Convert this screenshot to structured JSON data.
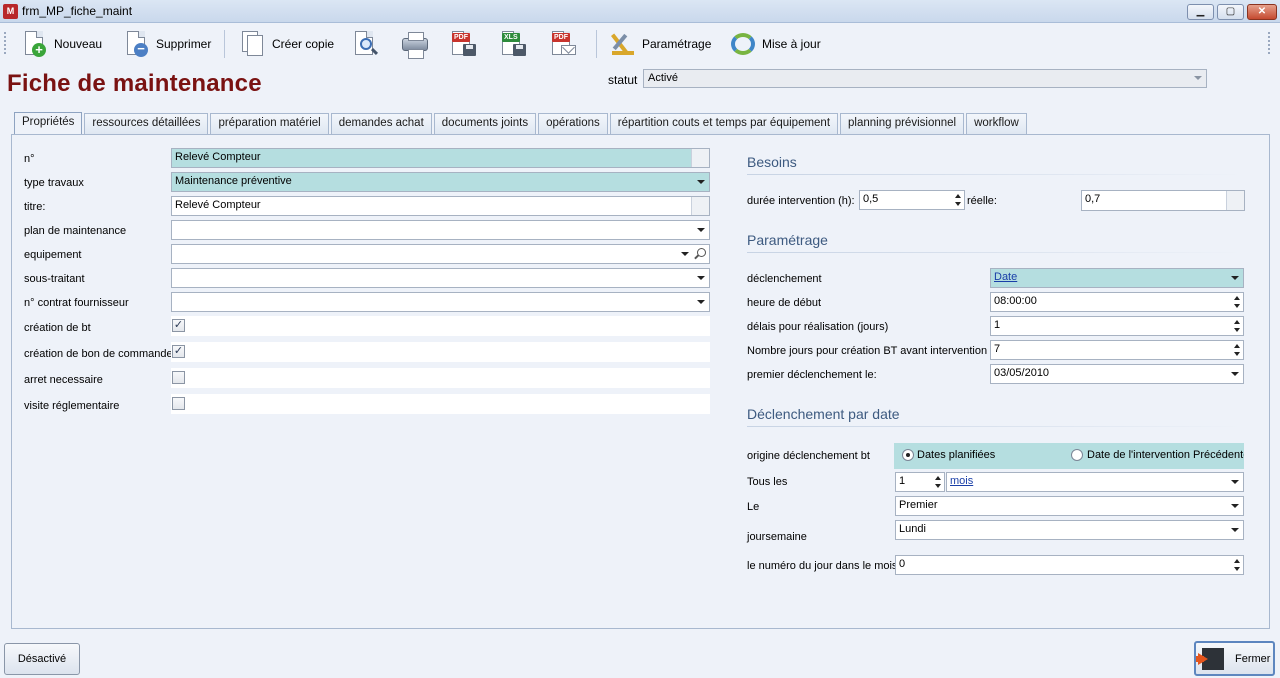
{
  "window": {
    "title": "frm_MP_fiche_maint",
    "app_icon": "app-icon",
    "min": "▁",
    "max": "▢",
    "close": "✕"
  },
  "toolbar": {
    "nouveau": "Nouveau",
    "supprimer": "Supprimer",
    "creer_copie": "Créer copie",
    "parametrage": "Paramétrage",
    "mise_a_jour": "Mise à jour",
    "pdf_tag": "PDF",
    "xls_tag": "XLS"
  },
  "header": {
    "title": "Fiche de maintenance",
    "statut_label": "statut",
    "statut_value": "Activé"
  },
  "tabs": [
    {
      "label": "Propriétés",
      "active": true
    },
    {
      "label": "ressources détaillées"
    },
    {
      "label": "préparation matériel"
    },
    {
      "label": "demandes achat"
    },
    {
      "label": "documents joints"
    },
    {
      "label": "opérations"
    },
    {
      "label": "répartition couts et temps par équipement"
    },
    {
      "label": "planning prévisionnel"
    },
    {
      "label": "workflow"
    }
  ],
  "left": {
    "no_label": "n°",
    "no_value": "Relevé Compteur",
    "type_label": "type travaux",
    "type_value": "Maintenance préventive",
    "titre_label": "titre:",
    "titre_value": "Relevé Compteur",
    "plan_label": "plan de maintenance",
    "plan_value": "",
    "equipement_label": "equipement",
    "equipement_value": "",
    "sous_traitant_label": "sous-traitant",
    "sous_traitant_value": "",
    "contrat_label": "n° contrat fournisseur",
    "contrat_value": "",
    "creation_bt_label": "création de bt",
    "creation_bt_checked": true,
    "creation_bon_label": "création de bon de commande",
    "creation_bon_checked": true,
    "arret_label": "arret  necessaire",
    "arret_checked": false,
    "visite_label": "visite réglementaire",
    "visite_checked": false,
    "check_mark": "✓"
  },
  "besoins": {
    "title": "Besoins",
    "duree_label": "durée intervention (h):",
    "duree_value": "0,5",
    "reelle_label": "réelle:",
    "reelle_value": "0,7"
  },
  "parametrage": {
    "title": "Paramétrage",
    "declenchement_label": "déclenchement",
    "declenchement_value": "Date",
    "heure_label": "heure de début",
    "heure_value": "08:00:00",
    "delais_label": "délais pour réalisation (jours)",
    "delais_value": "1",
    "nb_jours_label": "Nombre jours pour création BT avant intervention",
    "nb_jours_value": "7",
    "premier_label": "premier déclenchement le:",
    "premier_value": "03/05/2010"
  },
  "par_date": {
    "title": "Déclenchement par date",
    "origine_label": "origine déclenchement bt",
    "radio_1": "Dates planifiées",
    "radio_2": "Date de l'intervention Précédente",
    "selected": "radio_1",
    "tous_les_label": "Tous les",
    "tous_les_value": "1",
    "tous_les_unit": "mois",
    "le_label": "Le",
    "le_value": "Premier",
    "joursemaine_label": "joursemaine",
    "joursemaine_value": "Lundi",
    "numero_label": "le numéro du jour dans le mois",
    "numero_value": "0"
  },
  "footer": {
    "desactive": "Désactivé",
    "fermer": "Fermer"
  }
}
